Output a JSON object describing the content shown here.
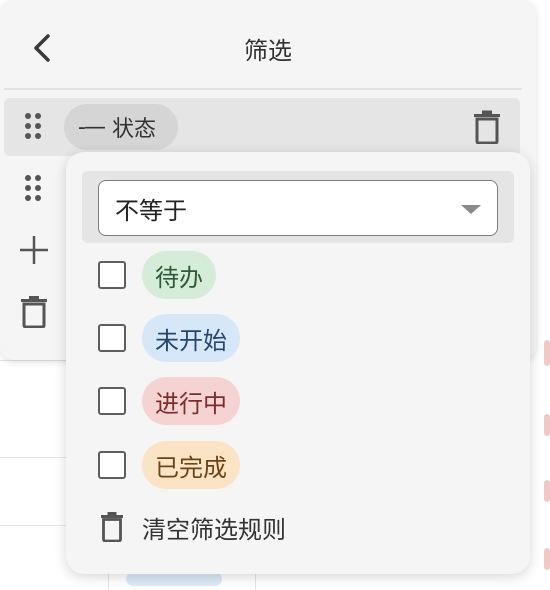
{
  "panel": {
    "title": "筛选",
    "rule": {
      "field": "状态",
      "operator_symbol": "-—"
    }
  },
  "popup": {
    "operator_selected": "不等于",
    "options": [
      {
        "label": "待办",
        "bg": "#d5ecd9",
        "fg": "#2e5a35"
      },
      {
        "label": "未开始",
        "bg": "#d6e8f8",
        "fg": "#28466b"
      },
      {
        "label": "进行中",
        "bg": "#f5d3d2",
        "fg": "#7a2e2b"
      },
      {
        "label": "已完成",
        "bg": "#fbe3c5",
        "fg": "#6b4416"
      }
    ],
    "clear_label": "清空筛选规则"
  },
  "icons": {
    "back": "chevron-left-icon",
    "drag": "drag-handle-icon",
    "trash": "trash-icon",
    "plus": "plus-icon",
    "caret": "caret-down-icon"
  }
}
